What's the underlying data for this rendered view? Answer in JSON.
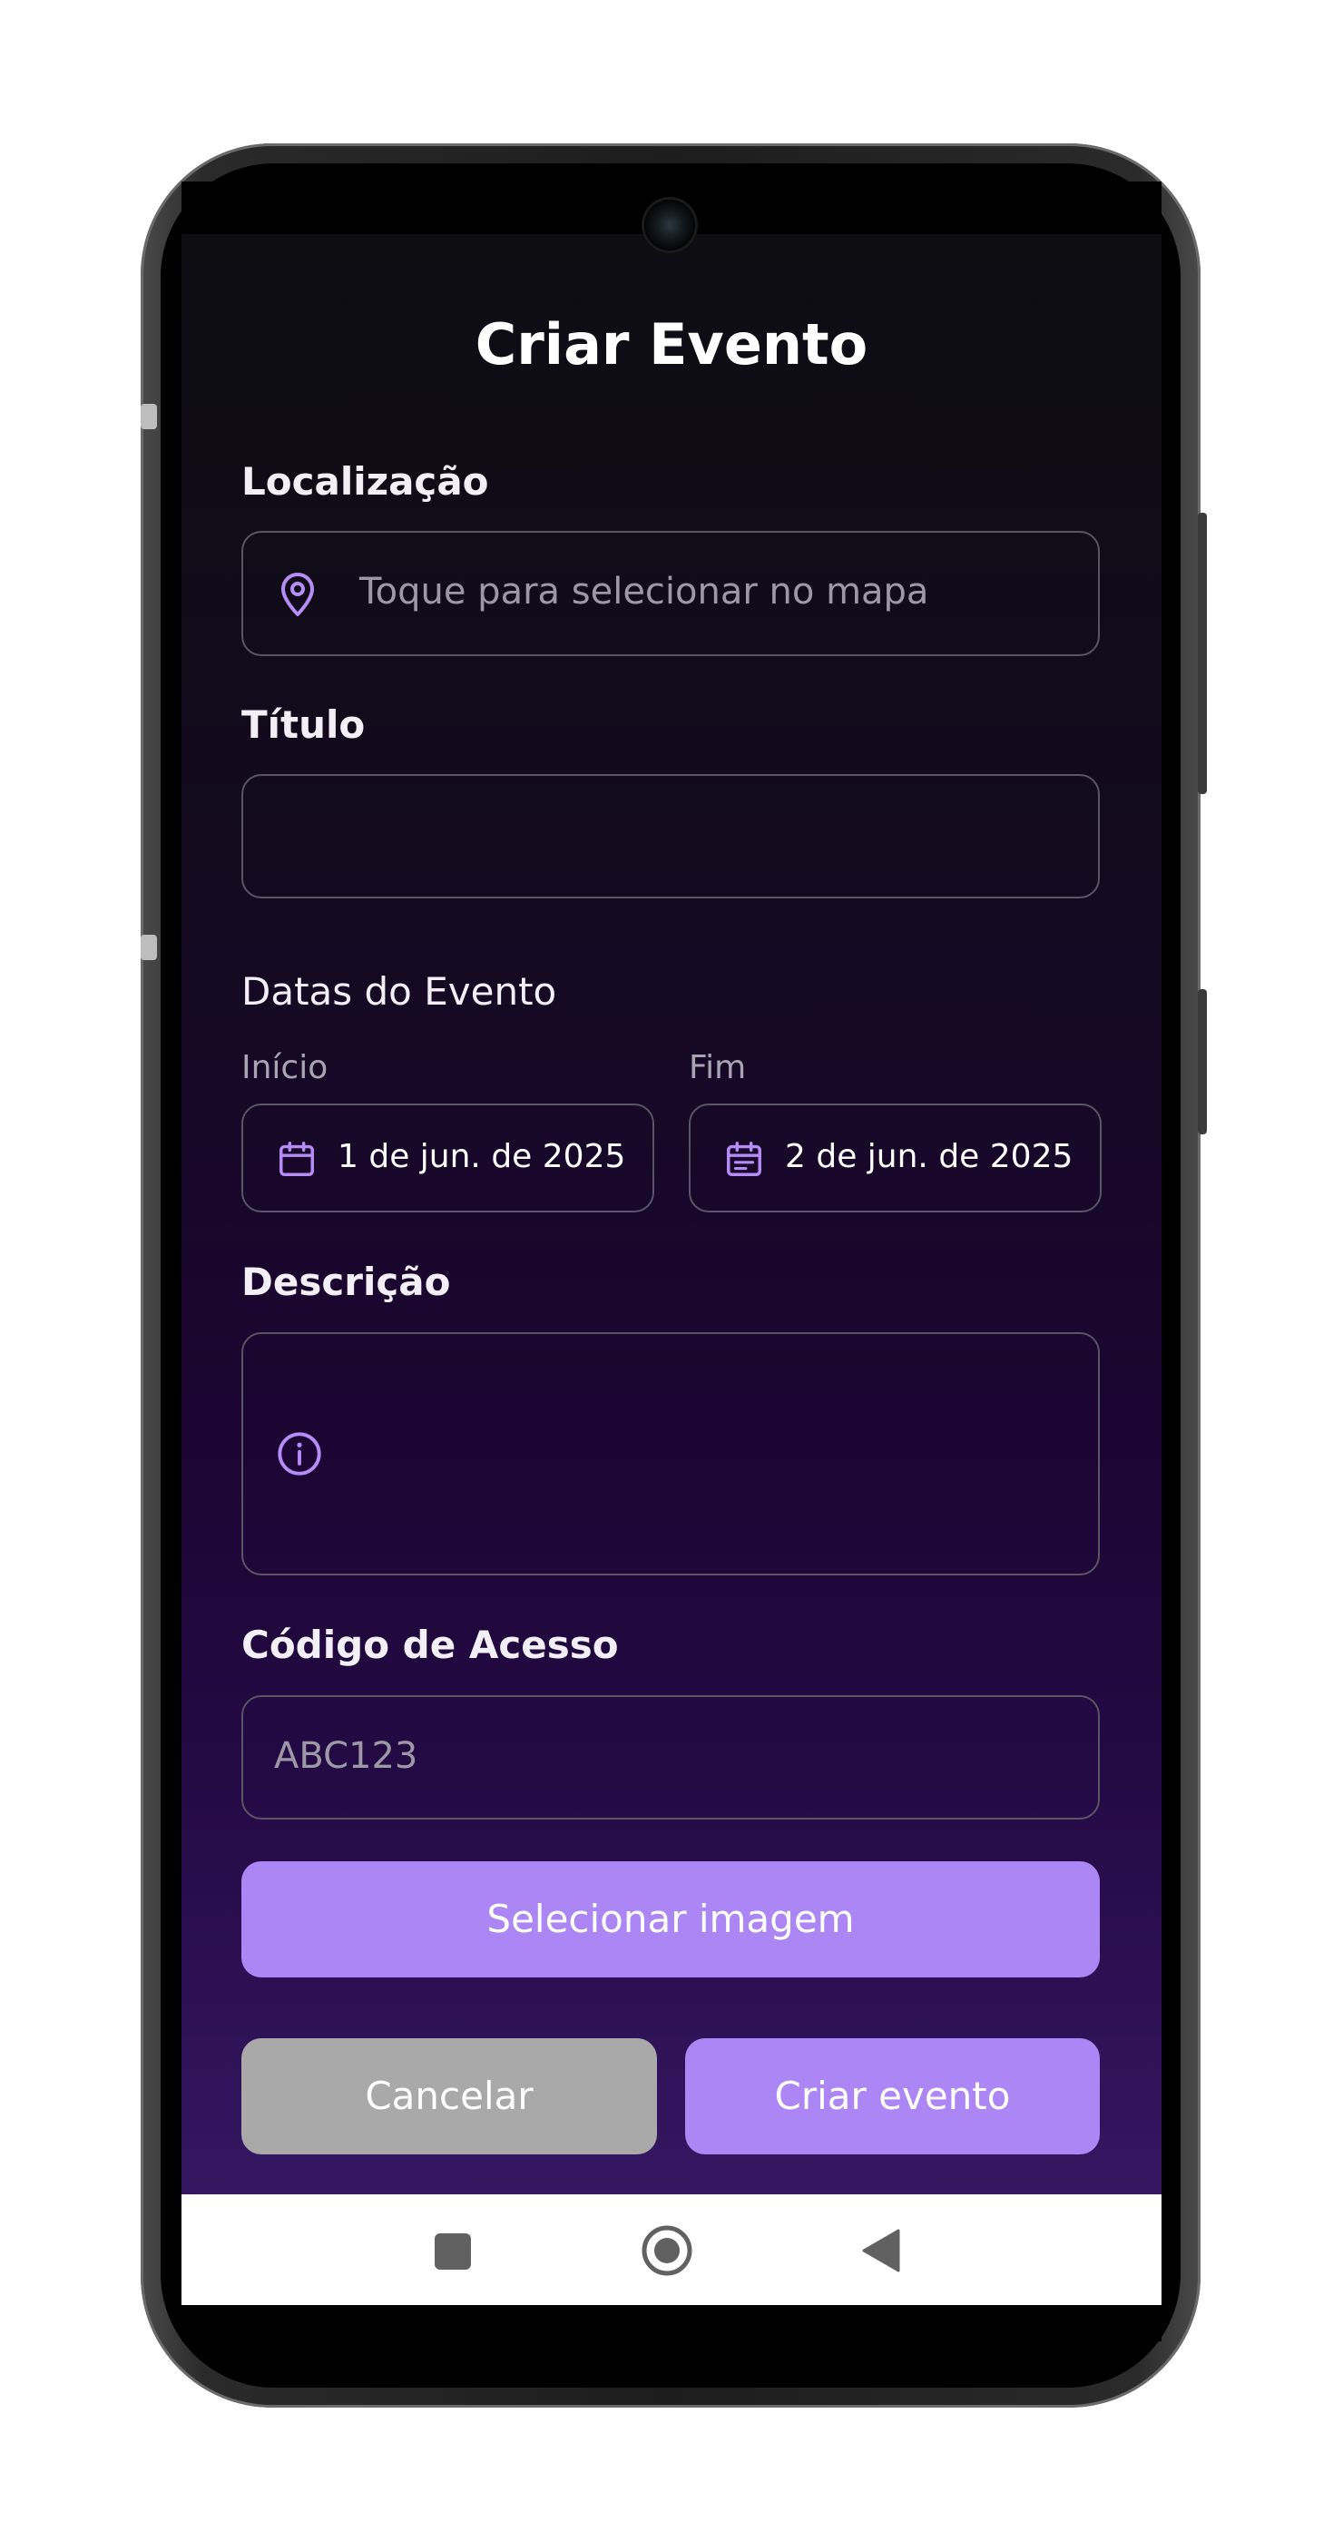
{
  "page": {
    "title": "Criar Evento"
  },
  "location": {
    "label": "Localização",
    "placeholder": "Toque para selecionar no mapa",
    "icon": "map-pin-icon"
  },
  "title_field": {
    "label": "Título",
    "value": ""
  },
  "dates": {
    "section_label": "Datas do Evento",
    "start": {
      "label": "Início",
      "value": "1 de jun. de 2025",
      "icon": "calendar-icon"
    },
    "end": {
      "label": "Fim",
      "value": "2 de jun. de 2025",
      "icon": "calendar-icon"
    }
  },
  "description": {
    "label": "Descrição",
    "value": "",
    "icon": "info-icon"
  },
  "access_code": {
    "label": "Código de Acesso",
    "placeholder": "ABC123"
  },
  "buttons": {
    "select_image": "Selecionar imagem",
    "cancel": "Cancelar",
    "create": "Criar evento"
  },
  "navbar": {
    "recents": "recents-square-icon",
    "home": "home-circle-icon",
    "back": "back-triangle-icon"
  },
  "colors": {
    "accent": "#ad86f5",
    "cancel": "#a9a9a9",
    "icon": "#b68cf7"
  }
}
